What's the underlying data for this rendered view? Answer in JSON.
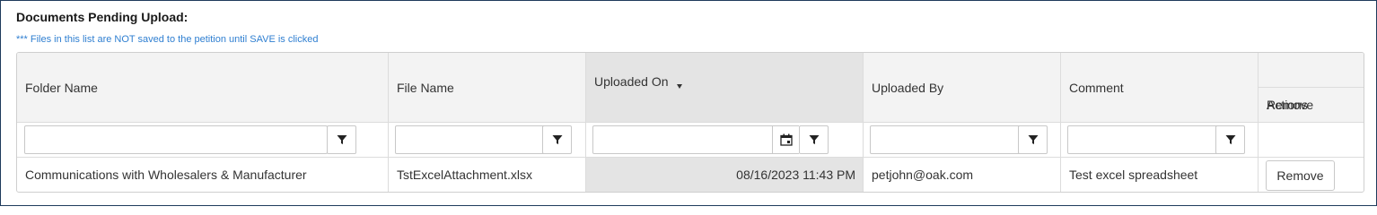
{
  "section": {
    "title": "Documents Pending Upload:",
    "notice": "*** Files in this list are NOT saved to the petition until SAVE is clicked"
  },
  "columns": {
    "folder_name": "Folder Name",
    "file_name": "File Name",
    "uploaded_on": "Uploaded On",
    "uploaded_by": "Uploaded By",
    "comment": "Comment",
    "actions": "Actions",
    "remove": "Remove"
  },
  "filters": {
    "folder_name": "",
    "file_name": "",
    "uploaded_on": "",
    "uploaded_by": "",
    "comment": ""
  },
  "rows": [
    {
      "folder_name": "Communications with Wholesalers & Manufacturer",
      "file_name": "TstExcelAttachment.xlsx",
      "uploaded_on": "08/16/2023 11:43 PM",
      "uploaded_by": "petjohn@oak.com",
      "comment": "Test excel spreadsheet",
      "action_label": "Remove"
    }
  ],
  "sort": {
    "column": "uploaded_on",
    "direction": "descending"
  },
  "colors": {
    "notice": "#2f7fd1",
    "header_bg": "#f3f3f3",
    "sorted_bg": "#e4e4e4",
    "frame_border": "#1f3b5c"
  },
  "icons": {
    "filter": "filter-icon",
    "calendar": "calendar-icon",
    "sort": "sort-down-icon"
  }
}
